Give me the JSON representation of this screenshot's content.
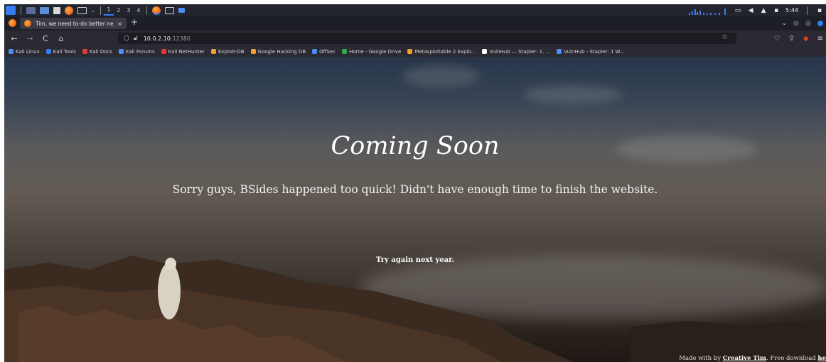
{
  "panel": {
    "workspaces": [
      "1",
      "2",
      "3",
      "4"
    ],
    "clock": "5:44"
  },
  "tab": {
    "title": "Tim, we need to-do better ne",
    "close": "×",
    "new_tab": "+"
  },
  "nav": {
    "back": "←",
    "forward": "→",
    "reload": "C",
    "home": "⌂",
    "url_host": "10.0.2.10",
    "url_port": ":12380",
    "bookmark_star": "☆"
  },
  "bookmarks": [
    {
      "label": "Kali Linux",
      "color": "#4c8df6"
    },
    {
      "label": "Kali Tools",
      "color": "#367bf0"
    },
    {
      "label": "Kali Docs",
      "color": "#e53935"
    },
    {
      "label": "Kali Forums",
      "color": "#4c8df6"
    },
    {
      "label": "Kali NetHunter",
      "color": "#e53935"
    },
    {
      "label": "Exploit-DB",
      "color": "#f0a030"
    },
    {
      "label": "Google Hacking DB",
      "color": "#f0a030"
    },
    {
      "label": "OffSec",
      "color": "#4c8df6"
    },
    {
      "label": "Home - Google Drive",
      "color": "#34a853"
    },
    {
      "label": "Metasploitable 2 Explo...",
      "color": "#f0a030"
    },
    {
      "label": "VulnHub — Stapler: 1. ...",
      "color": "#ffffff"
    },
    {
      "label": "VulnHub - Stapler: 1 W...",
      "color": "#4c8df6"
    }
  ],
  "page": {
    "title": "Coming Soon",
    "subtitle": "Sorry guys, BSides happened too quick! Didn't have enough time to finish the website.",
    "tagline": "Try again next year.",
    "footer_prefix": "Made with by ",
    "footer_link": "Creative Tim",
    "footer_mid": ". Free download ",
    "footer_link2": "he"
  }
}
